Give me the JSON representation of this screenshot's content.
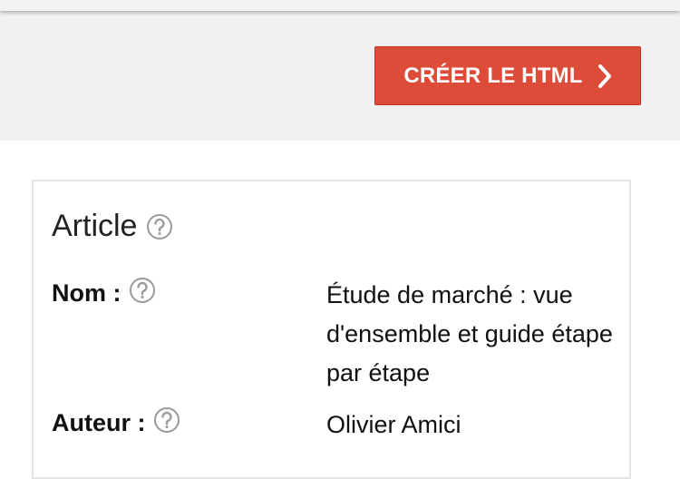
{
  "toolbar": {
    "create_button_label": "CRÉER LE HTML",
    "create_button_icon": "chevron-right-icon",
    "accent_color": "#dd4b39"
  },
  "article": {
    "title": "Article",
    "help_icon": "question-circle-icon",
    "fields": [
      {
        "label": "Nom :",
        "value": "Étude de marché : vue d'ensemble et guide étape par étape"
      },
      {
        "label": "Auteur :",
        "value": "Olivier Amici"
      }
    ]
  }
}
